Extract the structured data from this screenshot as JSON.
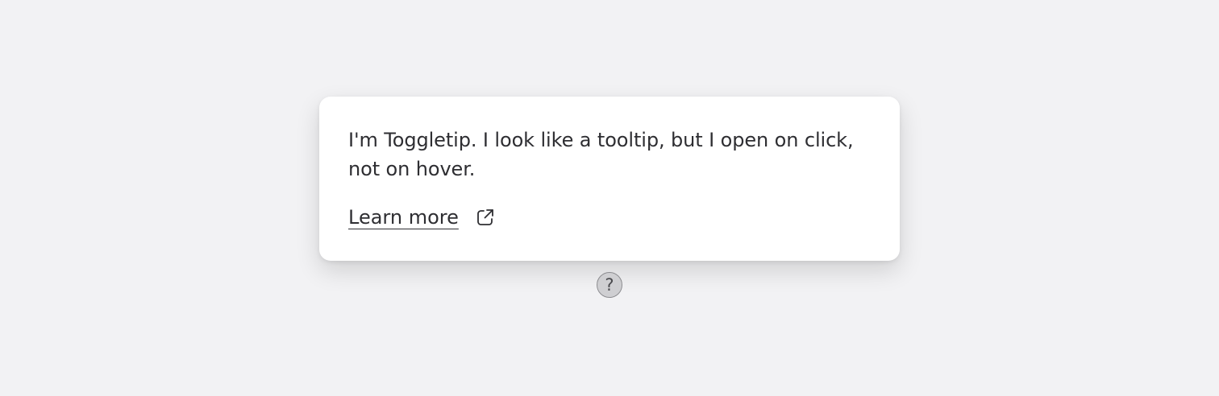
{
  "toggletip": {
    "text": "I'm Toggletip. I look like a tooltip, but I open on click, not on hover.",
    "link_label": "Learn more",
    "link_icon": "external-link-icon"
  },
  "trigger": {
    "glyph": "?",
    "icon": "question-mark-icon"
  },
  "colors": {
    "background": "#f2f2f4",
    "panel": "#ffffff",
    "text": "#2e2e32",
    "trigger_fill": "#cfcfd2",
    "trigger_border": "#8c8c90"
  }
}
